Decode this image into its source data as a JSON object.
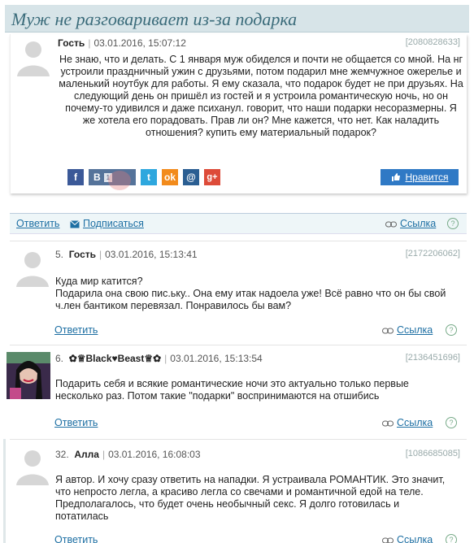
{
  "page_title": "Муж не разговаривает из-за подарка",
  "post": {
    "author": "Гость",
    "date": "03.01.2016, 15:07:12",
    "id": "[2080828633]",
    "text": "Не знаю, что и делать. С 1 января муж обиделся и почти не общается со мной. На нг устроили праздничный ужин с друзьями, потом подарил мне жемчужное ожерелье и маленький ноутбук для работы. Я ему сказала, что подарок будет не при друзьях. На следующий день он пришёл из гостей и я устроила романтическую ночь, но он почему-то удивился и даже психанул. говорит, что наши подарки несоразмерны. Я же хотела его порадовать. Прав ли он? Мне кажется, что нет. Как наладить отношения? купить ему материальный подарок?",
    "social": {
      "fb": "f",
      "vk": "В",
      "vk_count": "1",
      "tw": "t",
      "ok": "ok",
      "mail": "@",
      "gp": "g+"
    },
    "like_label": "Нравится"
  },
  "actions": {
    "reply": "Ответить",
    "subscribe": "Подписаться",
    "link": "Ссылка",
    "help": "?"
  },
  "comments": [
    {
      "num": "5.",
      "author": "Гость",
      "date": "03.01.2016, 15:13:41",
      "id": "[2172206062]",
      "text": "Куда мир катится?\nПодарила она свою пис.ьку.. Она ему итак надоела уже! Всё равно что он бы свой ч.лен бантиком перевязал. Понравилось бы вам?",
      "reply": "Ответить",
      "link": "Ссылка"
    },
    {
      "num": "6.",
      "author": "✿♕Black♥Beast♕✿",
      "date": "03.01.2016, 15:13:54",
      "id": "[2136451696]",
      "text": "Подарить себя и всякие романтические ночи это актуально только первые несколько раз. Потом такие \"подарки\" воспринимаются на отшибись",
      "reply": "Ответить",
      "link": "Ссылка"
    },
    {
      "num": "32.",
      "author": "Алла",
      "date": "03.01.2016, 16:08:03",
      "id": "[1086685085]",
      "text": "Я автор. И хочу сразу ответить на нападки. Я устраивала РОМАНТИК. Это значит, что непросто легла, а красиво легла со свечами и романтичной едой на теле. Предполагалось, что будет очень необычный секс. Я долго готовилась и потатилась",
      "reply": "Ответить",
      "link": "Ссылка"
    }
  ]
}
